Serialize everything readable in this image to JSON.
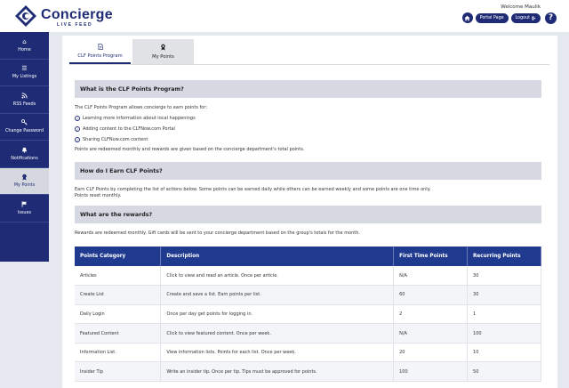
{
  "header": {
    "brand": "Concierge",
    "brand_sub": "LIVE FEED",
    "welcome": "Welcome Maulik",
    "portal_page_label": "Portal Page",
    "logout_label": "Logout",
    "help_label": "?"
  },
  "sidebar": {
    "items": [
      {
        "label": "Home",
        "icon": "home-icon"
      },
      {
        "label": "My Listings",
        "icon": "list-icon"
      },
      {
        "label": "RSS Feeds",
        "icon": "rss-icon"
      },
      {
        "label": "Change Password",
        "icon": "key-icon"
      },
      {
        "label": "Notifications",
        "icon": "bell-icon"
      },
      {
        "label": "My Points",
        "icon": "award-icon"
      },
      {
        "label": "Issues",
        "icon": "flag-icon"
      }
    ]
  },
  "tabs": [
    {
      "label": "CLF Points Program",
      "icon": "document-icon"
    },
    {
      "label": "My Points",
      "icon": "award-icon"
    }
  ],
  "content": {
    "section1_title": "What is the CLF Points Program?",
    "section1_intro": "The CLF Points Program allows concierge to earn points for:",
    "section1_items": [
      "Learning more information about local happenings",
      "Adding content to the CLFNow.com Portal",
      "Sharing CLFNow.com content"
    ],
    "section1_footer": "Points are redeemed monthly and rewards are given based on the concierge department's total points.",
    "section2_title": "How do I Earn CLF Points?",
    "section2_text1": "Earn CLF Points by completing the list of actions below. Some points can be earned daily while others can be earned weekly and some points are one time only.",
    "section2_text2": "Points reset monthly.",
    "section3_title": "What are the rewards?",
    "section3_text": "Rewards are redeemed monthly. Gift cards will be sent to your concierge department based on the group's totals for the month."
  },
  "table": {
    "headers": [
      "Points Category",
      "Description",
      "First Time Points",
      "Recurring Points"
    ],
    "rows": [
      [
        "Articles",
        "Click to view and read an article. Once per article.",
        "N/A",
        "30"
      ],
      [
        "Create List",
        "Create and save a list. Earn points per list.",
        "60",
        "30"
      ],
      [
        "Daily Login",
        "Once per day get points for logging in.",
        "2",
        "1"
      ],
      [
        "Featured Content",
        "Click to view featured content. Once per week.",
        "N/A",
        "100"
      ],
      [
        "Information List",
        "View information lists. Points for each list. Once per week.",
        "20",
        "10"
      ],
      [
        "Insider Tip",
        "Write an insider tip. Once per tip. Tips must be approved for points.",
        "100",
        "50"
      ]
    ]
  },
  "colors": {
    "brand": "#1f2c75",
    "table_header": "#1f3a8f",
    "section_bg": "#d6d8e2"
  }
}
